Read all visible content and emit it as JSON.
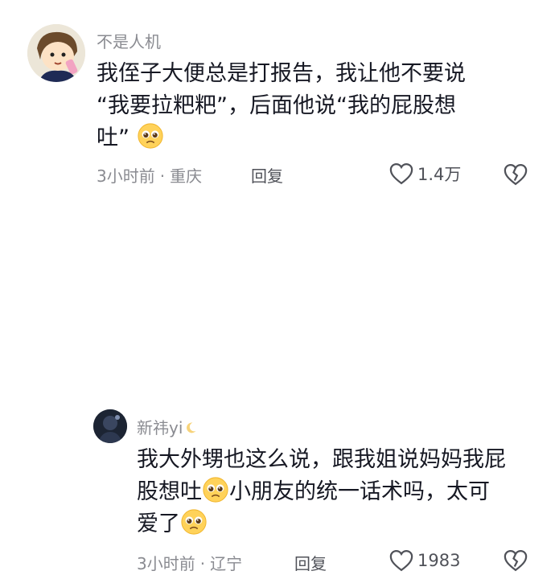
{
  "comments": [
    {
      "username": "不是人机",
      "text_lines": [
        "我侄子大便总是打报告，我让他不要说",
        "“我要拉粑粑”，后面他说“我的屁股想",
        "吐”"
      ],
      "time": "3小时前",
      "location": "重庆",
      "reply_label": "回复",
      "likes": "1.4万",
      "avatar_icon": "cartoon-avatar-icon"
    },
    {
      "username": "新祎yi",
      "text_lines": [
        "我大外甥也这么说，跟我姐说妈妈我屁",
        "股想吐",
        "小朋友的统一话术吗，太可",
        "爱了"
      ],
      "time": "3小时前",
      "location": "辽宁",
      "reply_label": "回复",
      "likes": "1983",
      "avatar_icon": "dark-avatar-icon"
    }
  ],
  "colors": {
    "text": "#161823",
    "meta": "#8a8b91",
    "icon": "#505259"
  }
}
